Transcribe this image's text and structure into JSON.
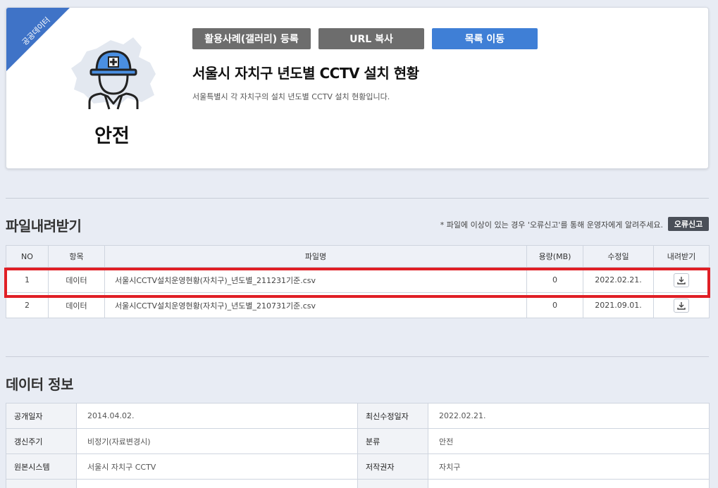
{
  "header": {
    "ribbon": "공공데이터",
    "category": "안전",
    "buttons": {
      "gallery": "활용사례(갤러리) 등록",
      "url_copy": "URL 복사",
      "list": "목록 이동"
    },
    "title": "서울시 자치구 년도별 CCTV 설치 현황",
    "description": "서울특별시 각 자치구의 설치 년도별 CCTV 설치 현황입니다.",
    "icons": {
      "category_icon": "safety-worker-icon",
      "background": "seoul-map-shape"
    },
    "colors": {
      "ribbon": "#3f73c7",
      "primary_button": "#3f7fd6",
      "secondary_button": "#6d6d6d"
    }
  },
  "files": {
    "title": "파일내려받기",
    "notice": "* 파일에 이상이 있는 경우 '오류신고'를 통해 운영자에게 알려주세요.",
    "report_button": "오류신고",
    "columns": {
      "no": "NO",
      "item": "항목",
      "name": "파일명",
      "size": "용량(MB)",
      "modified": "수정일",
      "download": "내려받기"
    },
    "rows": [
      {
        "no": "1",
        "item": "데이터",
        "name": "서울시CCTV설치운영현황(자치구)_년도별_211231기준.csv",
        "size": "0",
        "modified": "2022.02.21."
      },
      {
        "no": "2",
        "item": "데이터",
        "name": "서울시CCTV설치운영현황(자치구)_년도별_210731기준.csv",
        "size": "0",
        "modified": "2021.09.01."
      }
    ],
    "highlight_color": "#e01f26"
  },
  "info": {
    "title": "데이터 정보",
    "rows": [
      {
        "k1": "공개일자",
        "v1": "2014.04.02.",
        "k2": "최신수정일자",
        "v2": "2022.02.21."
      },
      {
        "k1": "갱신주기",
        "v1": "비정기(자료변경시)",
        "k2": "분류",
        "v2": "안전"
      },
      {
        "k1": "원본시스템",
        "v1": "서울시 자치구 CCTV",
        "k2": "저작권자",
        "v2": "자치구"
      },
      {
        "k1": "",
        "v1": "",
        "k2": "",
        "v2": ""
      }
    ]
  }
}
